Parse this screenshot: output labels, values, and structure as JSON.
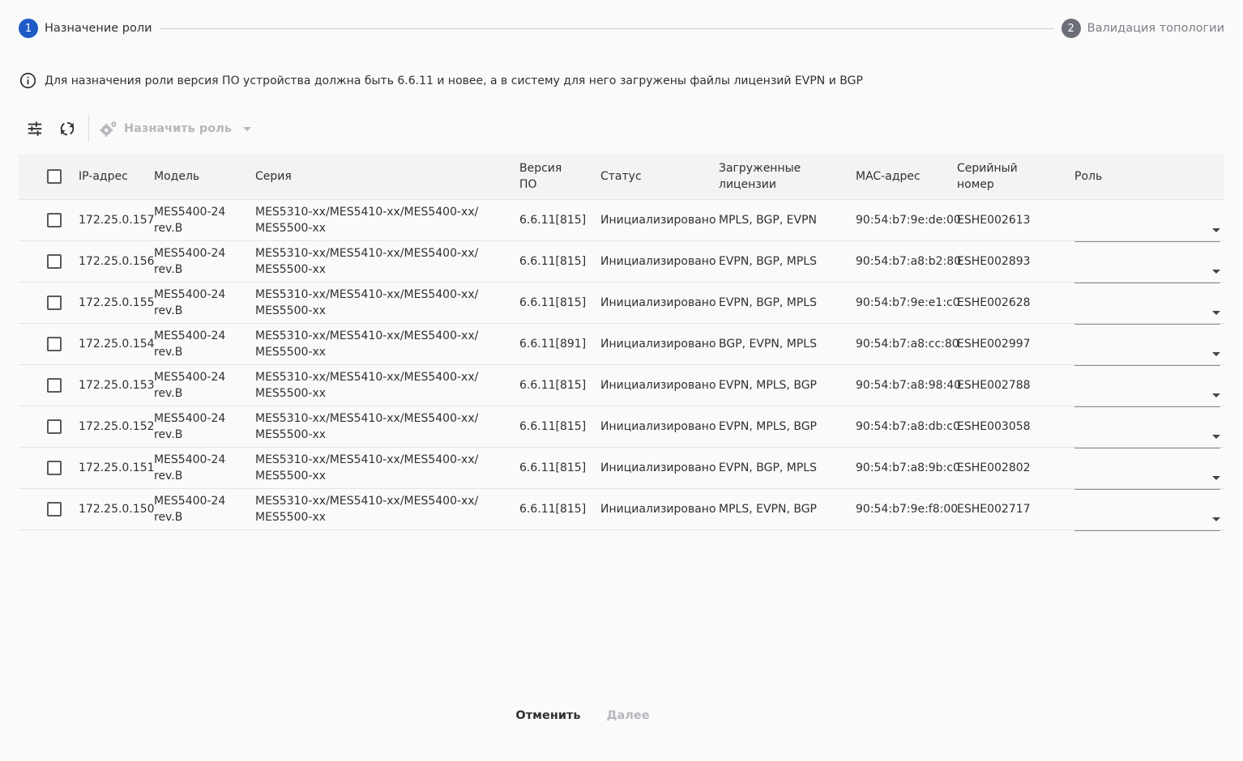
{
  "stepper": {
    "steps": [
      {
        "num": "1",
        "label": "Назначение роли"
      },
      {
        "num": "2",
        "label": "Валидация топологии"
      }
    ]
  },
  "info": {
    "icon": "info-circle-icon",
    "text": "Для назначения роли версия ПО устройства должна быть 6.6.11 и новее, а в систему для него загружены файлы лицензий EVPN и BGP"
  },
  "toolbar": {
    "filter_icon": "sliders-icon",
    "refresh_icon": "refresh-icon",
    "assign_icon": "gears-icon",
    "assign_label": "Назначить роль"
  },
  "table": {
    "headers": {
      "ip": "IP-адрес",
      "model": "Модель",
      "series": "Серия",
      "version_line1": "Версия",
      "version_line2": "ПО",
      "status": "Статус",
      "licenses_line1": "Загруженные",
      "licenses_line2": "лицензии",
      "mac": "MAC-адрес",
      "serial_line1": "Серийный",
      "serial_line2": "номер",
      "role": "Роль"
    },
    "rows": [
      {
        "ip": "172.25.0.157",
        "model1": "MES5400-24",
        "model2": "rev.B",
        "series1": "MES5310-xx/MES5410-xx/MES5400-xx/",
        "series2": "MES5500-xx",
        "version": "6.6.11[815]",
        "status": "Инициализировано",
        "licenses": "MPLS, BGP, EVPN",
        "mac": "90:54:b7:9e:de:00",
        "serial": "ESHE002613"
      },
      {
        "ip": "172.25.0.156",
        "model1": "MES5400-24",
        "model2": "rev.B",
        "series1": "MES5310-xx/MES5410-xx/MES5400-xx/",
        "series2": "MES5500-xx",
        "version": "6.6.11[815]",
        "status": "Инициализировано",
        "licenses": "EVPN, BGP, MPLS",
        "mac": "90:54:b7:a8:b2:80",
        "serial": "ESHE002893"
      },
      {
        "ip": "172.25.0.155",
        "model1": "MES5400-24",
        "model2": "rev.B",
        "series1": "MES5310-xx/MES5410-xx/MES5400-xx/",
        "series2": "MES5500-xx",
        "version": "6.6.11[815]",
        "status": "Инициализировано",
        "licenses": "EVPN, BGP, MPLS",
        "mac": "90:54:b7:9e:e1:c0",
        "serial": "ESHE002628"
      },
      {
        "ip": "172.25.0.154",
        "model1": "MES5400-24",
        "model2": "rev.B",
        "series1": "MES5310-xx/MES5410-xx/MES5400-xx/",
        "series2": "MES5500-xx",
        "version": "6.6.11[891]",
        "status": "Инициализировано",
        "licenses": "BGP, EVPN, MPLS",
        "mac": "90:54:b7:a8:cc:80",
        "serial": "ESHE002997"
      },
      {
        "ip": "172.25.0.153",
        "model1": "MES5400-24",
        "model2": "rev.B",
        "series1": "MES5310-xx/MES5410-xx/MES5400-xx/",
        "series2": "MES5500-xx",
        "version": "6.6.11[815]",
        "status": "Инициализировано",
        "licenses": "EVPN, MPLS, BGP",
        "mac": "90:54:b7:a8:98:40",
        "serial": "ESHE002788"
      },
      {
        "ip": "172.25.0.152",
        "model1": "MES5400-24",
        "model2": "rev.B",
        "series1": "MES5310-xx/MES5410-xx/MES5400-xx/",
        "series2": "MES5500-xx",
        "version": "6.6.11[815]",
        "status": "Инициализировано",
        "licenses": "EVPN, MPLS, BGP",
        "mac": "90:54:b7:a8:db:c0",
        "serial": "ESHE003058"
      },
      {
        "ip": "172.25.0.151",
        "model1": "MES5400-24",
        "model2": "rev.B",
        "series1": "MES5310-xx/MES5410-xx/MES5400-xx/",
        "series2": "MES5500-xx",
        "version": "6.6.11[815]",
        "status": "Инициализировано",
        "licenses": "EVPN, BGP, MPLS",
        "mac": "90:54:b7:a8:9b:c0",
        "serial": "ESHE002802"
      },
      {
        "ip": "172.25.0.150",
        "model1": "MES5400-24",
        "model2": "rev.B",
        "series1": "MES5310-xx/MES5410-xx/MES5400-xx/",
        "series2": "MES5500-xx",
        "version": "6.6.11[815]",
        "status": "Инициализировано",
        "licenses": "MPLS, EVPN, BGP",
        "mac": "90:54:b7:9e:f8:00",
        "serial": "ESHE002717"
      }
    ]
  },
  "footer": {
    "cancel_label": "Отменить",
    "next_label": "Далее"
  },
  "colors": {
    "accent": "#1e5bc6",
    "step_inactive": "#6c6f78",
    "disabled_text": "#b5b7bc"
  }
}
